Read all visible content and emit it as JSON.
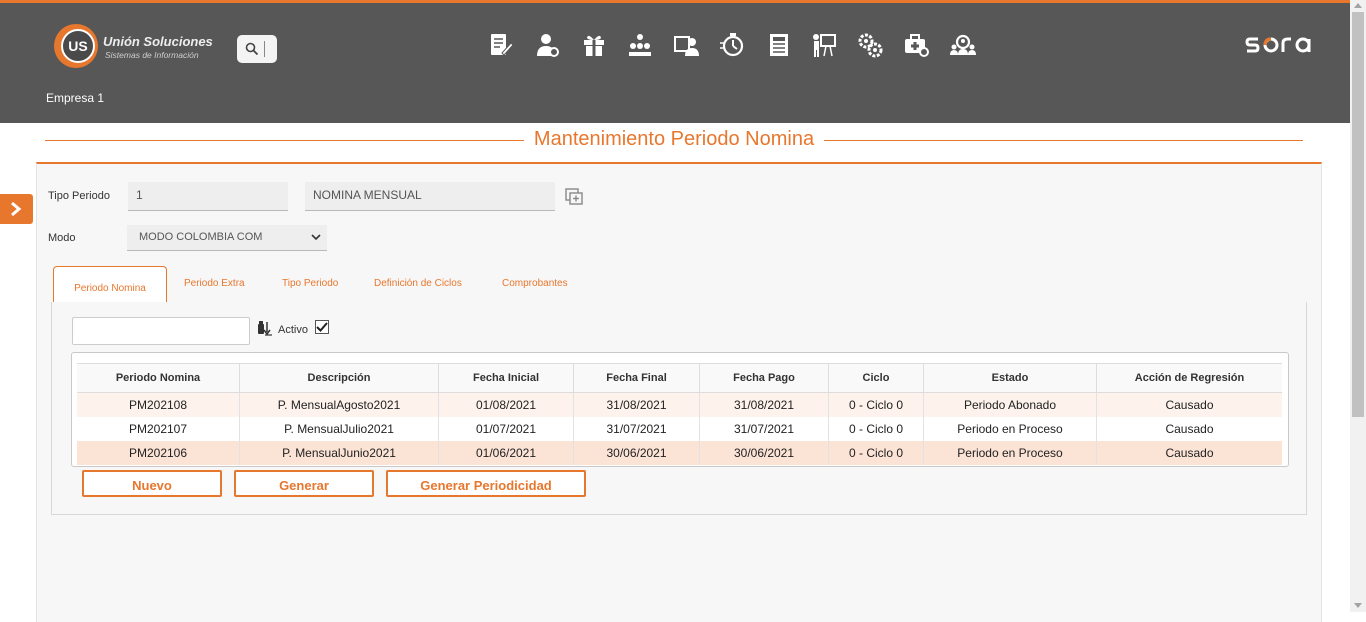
{
  "header": {
    "logo_name": "Unión Soluciones",
    "logo_sub": "Sistemas de Información",
    "logo_mark": "US",
    "brand": "sora",
    "company": "Empresa 1",
    "nav_icons": [
      "documents-edit-icon",
      "user-settings-icon",
      "gift-icon",
      "hierarchy-icon",
      "user-id-card-icon",
      "timer-icon",
      "newspaper-icon",
      "presentation-icon",
      "gears-icon",
      "medical-case-icon",
      "team-search-icon"
    ]
  },
  "page": {
    "title": "Mantenimiento Periodo Nomina"
  },
  "form": {
    "tipo_periodo_label": "Tipo Periodo",
    "tipo_periodo_code": "1",
    "tipo_periodo_name": "NOMINA MENSUAL",
    "modo_label": "Modo",
    "modo_value": "MODO COLOMBIA COM"
  },
  "tabs": [
    "Periodo Nomina",
    "Periodo Extra",
    "Tipo Periodo",
    "Definición de Ciclos",
    "Comprobantes"
  ],
  "filter": {
    "search_value": "",
    "activo_label": "Activo",
    "activo_checked": true
  },
  "table": {
    "columns": [
      "Periodo Nomina",
      "Descripción",
      "Fecha Inicial",
      "Fecha Final",
      "Fecha Pago",
      "Ciclo",
      "Estado",
      "Acción de Regresión"
    ],
    "rows": [
      [
        "PM202108",
        "P. MensualAgosto2021",
        "01/08/2021",
        "31/08/2021",
        "31/08/2021",
        "0 - Ciclo 0",
        "Periodo Abonado",
        "Causado"
      ],
      [
        "PM202107",
        "P. MensualJulio2021",
        "01/07/2021",
        "31/07/2021",
        "31/07/2021",
        "0 - Ciclo 0",
        "Periodo en Proceso",
        "Causado"
      ],
      [
        "PM202106",
        "P. MensualJunio2021",
        "01/06/2021",
        "30/06/2021",
        "30/06/2021",
        "0 - Ciclo 0",
        "Periodo en Proceso",
        "Causado"
      ]
    ]
  },
  "buttons": {
    "nuevo": "Nuevo",
    "generar": "Generar",
    "generar_periodicidad": "Generar Periodicidad"
  },
  "colors": {
    "accent": "#e8772e",
    "header_bg": "#575757",
    "row_odd": "#fdf3ec",
    "row_selected": "#fbe3d6"
  }
}
